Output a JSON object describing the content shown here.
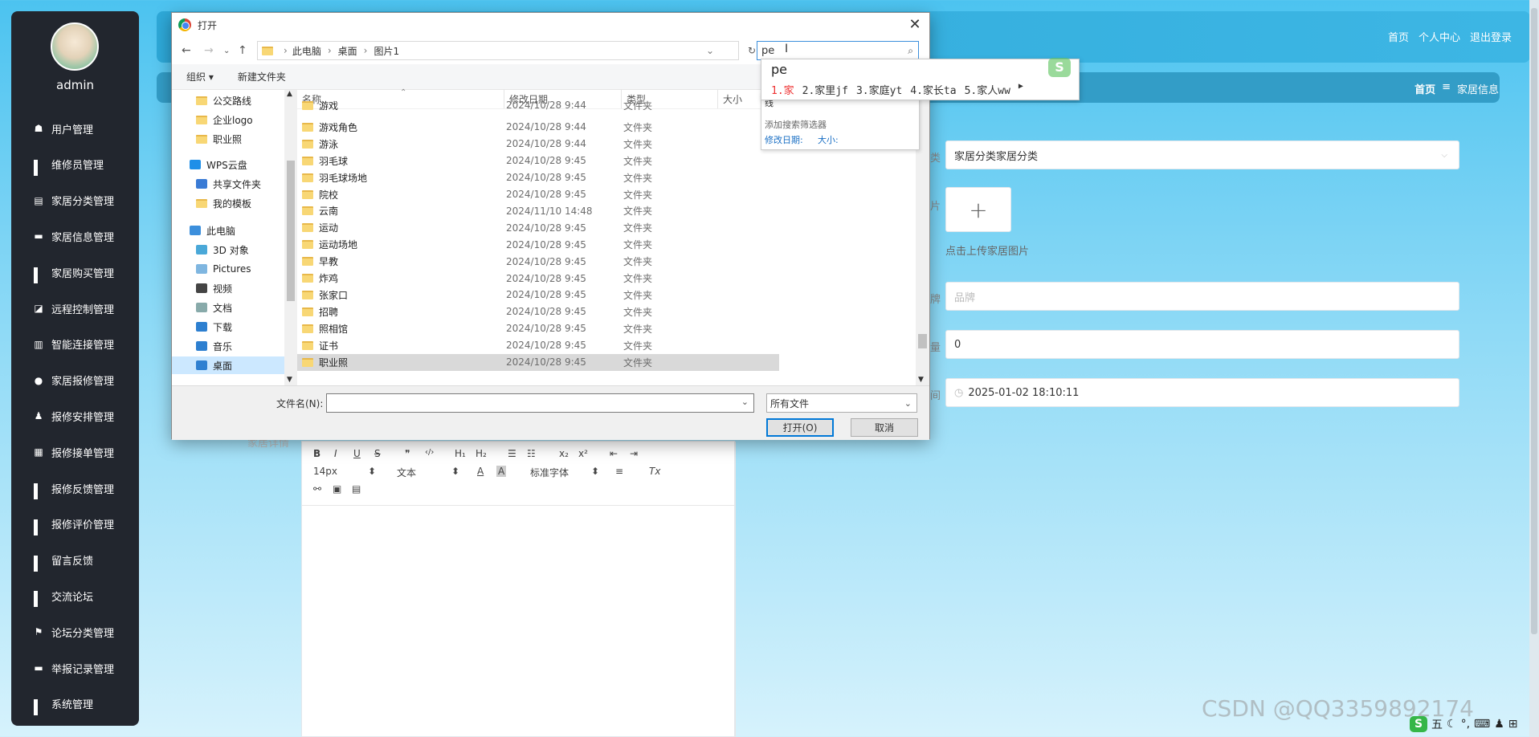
{
  "app": {
    "user": "admin",
    "nav": [
      {
        "label": "用户管理",
        "icon": "user-icon"
      },
      {
        "label": "维修员管理",
        "icon": "grid-icon"
      },
      {
        "label": "家居分类管理",
        "icon": "clipboard-icon"
      },
      {
        "label": "家居信息管理",
        "icon": "monitor-icon"
      },
      {
        "label": "家居购买管理",
        "icon": "grid-icon"
      },
      {
        "label": "远程控制管理",
        "icon": "chart-icon"
      },
      {
        "label": "智能连接管理",
        "icon": "bar-chart-icon"
      },
      {
        "label": "家居报修管理",
        "icon": "bulb-icon"
      },
      {
        "label": "报修安排管理",
        "icon": "person-icon"
      },
      {
        "label": "报修接单管理",
        "icon": "building-icon"
      },
      {
        "label": "报修反馈管理",
        "icon": "grid-icon"
      },
      {
        "label": "报修评价管理",
        "icon": "grid-icon"
      },
      {
        "label": "留言反馈",
        "icon": "grid-icon"
      },
      {
        "label": "交流论坛",
        "icon": "grid-icon"
      },
      {
        "label": "论坛分类管理",
        "icon": "flag-icon"
      },
      {
        "label": "举报记录管理",
        "icon": "chat-icon"
      },
      {
        "label": "系统管理",
        "icon": "grid-icon"
      }
    ],
    "top_links": {
      "home": "首页",
      "profile": "个人中心",
      "logout": "退出登录"
    },
    "breadcrumb": {
      "home": "首页",
      "sep": "≡",
      "current": "家居信息"
    },
    "form": {
      "category_value": "家居分类家居分类",
      "upload_plus": "+",
      "upload_hint": "点击上传家居图片",
      "brand_placeholder": "品牌",
      "number_value": "0",
      "datetime_value": "2025-01-02 18:10:11",
      "detail_label": "家居详情",
      "label_fragment_1": "类",
      "label_fragment_2": "片",
      "label_fragment_3": "牌",
      "label_fragment_4": "量",
      "label_fragment_5": "间"
    },
    "editor": {
      "font_size": "14px",
      "text_style": "文本",
      "font_family": "标准字体",
      "b": "B",
      "i": "I",
      "u": "U",
      "s": "S",
      "quote": "❞",
      "code": "‹/›",
      "h1": "H₁",
      "h2": "H₂",
      "sub": "x₂",
      "sup": "x²",
      "clear": "Tx"
    }
  },
  "dialog": {
    "title": "打开",
    "close": "✕",
    "path": [
      "此电脑",
      "桌面",
      "图片1"
    ],
    "search_value": "pe",
    "organize": "组织 ▾",
    "new_folder": "新建文件夹",
    "tree": [
      {
        "label": "公交路线",
        "type": "folder"
      },
      {
        "label": "企业logo",
        "type": "folder"
      },
      {
        "label": "职业照",
        "type": "folder"
      },
      {
        "label": "WPS云盘",
        "type": "cloud"
      },
      {
        "label": "共享文件夹",
        "type": "share"
      },
      {
        "label": "我的模板",
        "type": "folder"
      },
      {
        "label": "此电脑",
        "type": "pc"
      },
      {
        "label": "3D 对象",
        "type": "3d"
      },
      {
        "label": "Pictures",
        "type": "pics"
      },
      {
        "label": "视频",
        "type": "video"
      },
      {
        "label": "文档",
        "type": "doc"
      },
      {
        "label": "下载",
        "type": "download"
      },
      {
        "label": "音乐",
        "type": "music"
      },
      {
        "label": "桌面",
        "type": "desktop"
      }
    ],
    "columns": [
      "名称",
      "修改日期",
      "类型",
      "大小"
    ],
    "files": [
      {
        "name": "游戏",
        "date": "2024/10/28 9:44",
        "type": "文件夹"
      },
      {
        "name": "游戏角色",
        "date": "2024/10/28 9:44",
        "type": "文件夹"
      },
      {
        "name": "游泳",
        "date": "2024/10/28 9:44",
        "type": "文件夹"
      },
      {
        "name": "羽毛球",
        "date": "2024/10/28 9:45",
        "type": "文件夹"
      },
      {
        "name": "羽毛球场地",
        "date": "2024/10/28 9:45",
        "type": "文件夹"
      },
      {
        "name": "院校",
        "date": "2024/10/28 9:45",
        "type": "文件夹"
      },
      {
        "name": "云南",
        "date": "2024/11/10 14:48",
        "type": "文件夹"
      },
      {
        "name": "运动",
        "date": "2024/10/28 9:45",
        "type": "文件夹"
      },
      {
        "name": "运动场地",
        "date": "2024/10/28 9:45",
        "type": "文件夹"
      },
      {
        "name": "早教",
        "date": "2024/10/28 9:45",
        "type": "文件夹"
      },
      {
        "name": "炸鸡",
        "date": "2024/10/28 9:45",
        "type": "文件夹"
      },
      {
        "name": "张家口",
        "date": "2024/10/28 9:45",
        "type": "文件夹"
      },
      {
        "name": "招聘",
        "date": "2024/10/28 9:45",
        "type": "文件夹"
      },
      {
        "name": "照相馆",
        "date": "2024/10/28 9:45",
        "type": "文件夹"
      },
      {
        "name": "证书",
        "date": "2024/10/28 9:45",
        "type": "文件夹"
      },
      {
        "name": "职业照",
        "date": "2024/10/28 9:45",
        "type": "文件夹"
      }
    ],
    "filename_label": "文件名(N):",
    "filename_value": "",
    "filetype": "所有文件",
    "open_button": "打开(O)",
    "cancel_button": "取消",
    "suggest": {
      "line1": "线",
      "add_filter": "添加搜索筛选器",
      "modified": "修改日期:",
      "size": "大小:"
    }
  },
  "ime": {
    "input": "pe",
    "candidates": [
      "1.家",
      "2.家里jf",
      "3.家庭yt",
      "4.家长ta",
      "5.家人ww"
    ],
    "logo": "S"
  },
  "watermark": "CSDN @QQ3359892174",
  "tray": {
    "ime_mode": "五"
  }
}
